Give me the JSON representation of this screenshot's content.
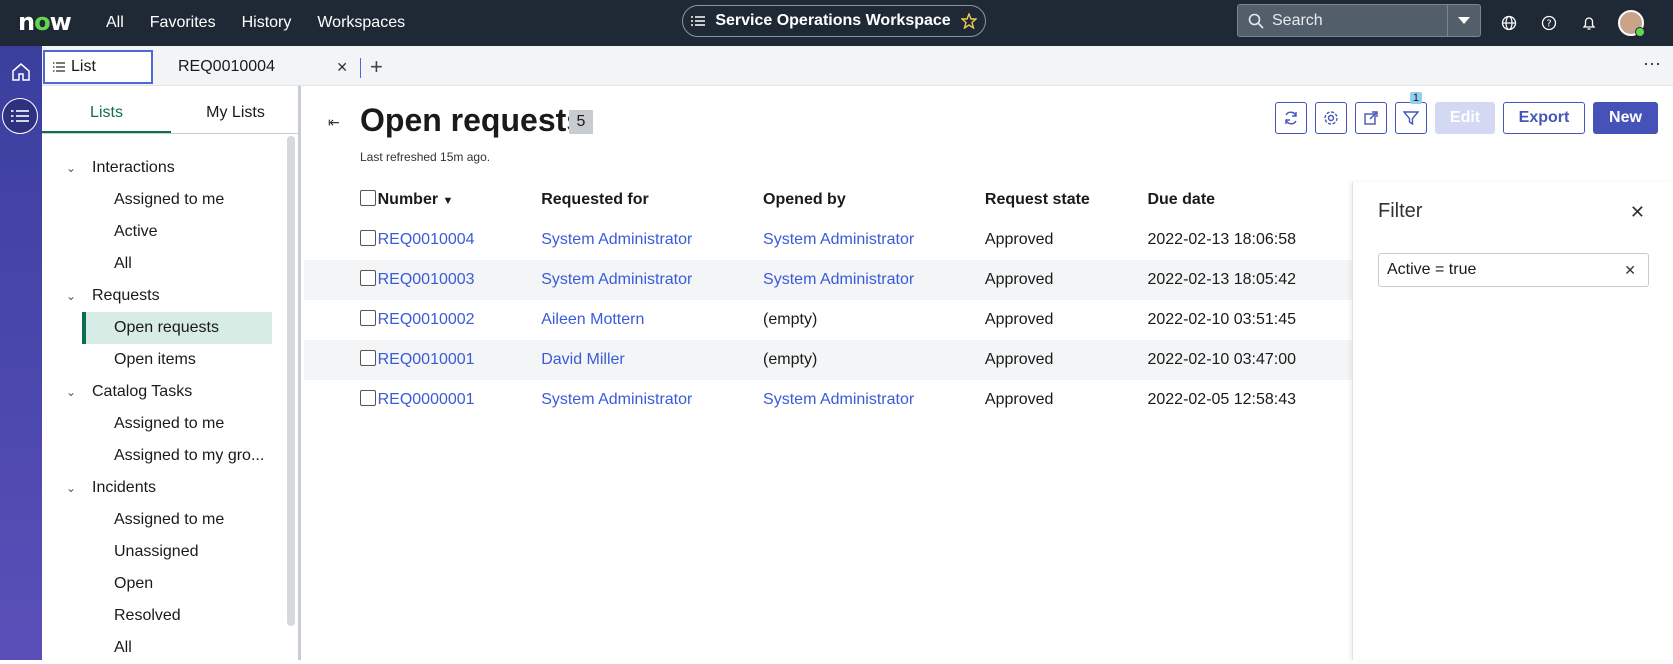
{
  "topbar": {
    "logo": "now",
    "nav": [
      "All",
      "Favorites",
      "History",
      "Workspaces"
    ],
    "workspace_label": "Service Operations Workspace",
    "search_placeholder": "Search"
  },
  "tabs": {
    "list_label": "List",
    "record_label": "REQ0010004"
  },
  "sidepanel": {
    "subtabs": [
      "Lists",
      "My Lists"
    ],
    "groups": [
      {
        "label": "Interactions",
        "items": [
          "Assigned to me",
          "Active",
          "All"
        ]
      },
      {
        "label": "Requests",
        "items": [
          "Open requests",
          "Open items"
        ]
      },
      {
        "label": "Catalog Tasks",
        "items": [
          "Assigned to me",
          "Assigned to my gro..."
        ]
      },
      {
        "label": "Incidents",
        "items": [
          "Assigned to me",
          "Unassigned",
          "Open",
          "Resolved",
          "All"
        ]
      }
    ]
  },
  "main": {
    "title": "Open requests",
    "count": "5",
    "refreshed": "Last refreshed 15m ago.",
    "filter_badge": "1",
    "edit_label": "Edit",
    "export_label": "Export",
    "new_label": "New"
  },
  "table": {
    "headers": [
      "Number",
      "Requested for",
      "Opened by",
      "Request state",
      "Due date"
    ],
    "rows": [
      [
        "REQ0010004",
        "System Administrator",
        "System Administrator",
        "Approved",
        "2022-02-13 18:06:58"
      ],
      [
        "REQ0010003",
        "System Administrator",
        "System Administrator",
        "Approved",
        "2022-02-13 18:05:42"
      ],
      [
        "REQ0010002",
        "Aileen Mottern",
        "(empty)",
        "Approved",
        "2022-02-10 03:51:45"
      ],
      [
        "REQ0010001",
        "David Miller",
        "(empty)",
        "Approved",
        "2022-02-10 03:47:00"
      ],
      [
        "REQ0000001",
        "System Administrator",
        "System Administrator",
        "Approved",
        "2022-02-05 12:58:43"
      ]
    ]
  },
  "filter": {
    "title": "Filter",
    "condition": "Active = true"
  },
  "colors": {
    "topbar": "#1f2935",
    "accent": "#4652b8",
    "link": "#3a5bd9",
    "selected_green": "#0e6e54"
  }
}
